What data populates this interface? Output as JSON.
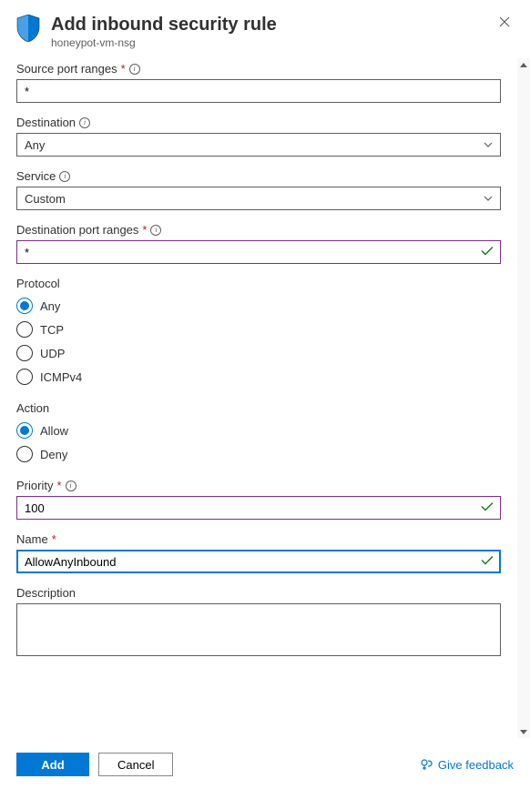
{
  "header": {
    "title": "Add inbound security rule",
    "subtitle": "honeypot-vm-nsg"
  },
  "sourcePortRanges": {
    "label": "Source port ranges",
    "value": "*"
  },
  "destination": {
    "label": "Destination",
    "value": "Any"
  },
  "service": {
    "label": "Service",
    "value": "Custom"
  },
  "destPortRanges": {
    "label": "Destination port ranges",
    "value": "*"
  },
  "protocol": {
    "label": "Protocol",
    "options": [
      "Any",
      "TCP",
      "UDP",
      "ICMPv4"
    ],
    "selected": "Any"
  },
  "action": {
    "label": "Action",
    "options": [
      "Allow",
      "Deny"
    ],
    "selected": "Allow"
  },
  "priority": {
    "label": "Priority",
    "value": "100"
  },
  "name": {
    "label": "Name",
    "value": "AllowAnyInbound"
  },
  "description": {
    "label": "Description",
    "value": ""
  },
  "footer": {
    "add": "Add",
    "cancel": "Cancel",
    "feedback": "Give feedback"
  }
}
